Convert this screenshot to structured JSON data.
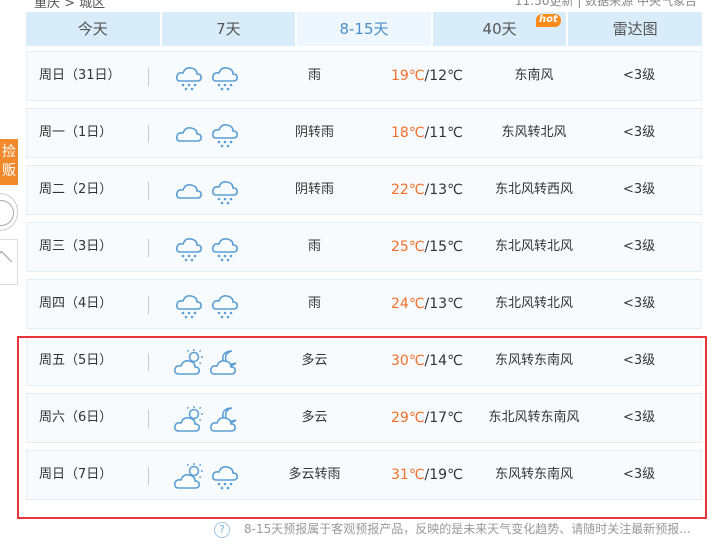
{
  "header": {
    "breadcrumb": "重庆 > 城区",
    "update_text": "11:50更新  |  数据来源 中央气象台"
  },
  "tabs": [
    {
      "label": "今天",
      "active": false
    },
    {
      "label": "7天",
      "active": false
    },
    {
      "label": "8-15天",
      "active": true
    },
    {
      "label": "40天",
      "active": false,
      "badge": "hot"
    },
    {
      "label": "雷达图",
      "active": false
    }
  ],
  "sidebar": {
    "button_label": "捡\n贩"
  },
  "forecast": [
    {
      "day": "周日（31日）",
      "icons": [
        "rain",
        "rain"
      ],
      "condition": "雨",
      "high": "19℃",
      "low": "12℃",
      "wind": "东南风",
      "level": "<3级"
    },
    {
      "day": "周一（1日）",
      "icons": [
        "cloudy",
        "rain"
      ],
      "condition": "阴转雨",
      "high": "18℃",
      "low": "11℃",
      "wind": "东风转北风",
      "level": "<3级"
    },
    {
      "day": "周二（2日）",
      "icons": [
        "cloudy",
        "rain"
      ],
      "condition": "阴转雨",
      "high": "22℃",
      "low": "13℃",
      "wind": "东北风转西风",
      "level": "<3级"
    },
    {
      "day": "周三（3日）",
      "icons": [
        "rain",
        "rain"
      ],
      "condition": "雨",
      "high": "25℃",
      "low": "15℃",
      "wind": "东北风转北风",
      "level": "<3级"
    },
    {
      "day": "周四（4日）",
      "icons": [
        "rain",
        "rain"
      ],
      "condition": "雨",
      "high": "24℃",
      "low": "13℃",
      "wind": "东北风转北风",
      "level": "<3级"
    },
    {
      "day": "周五（5日）",
      "icons": [
        "partly-cloudy-day",
        "partly-cloudy-night"
      ],
      "condition": "多云",
      "high": "30℃",
      "low": "14℃",
      "wind": "东风转东南风",
      "level": "<3级"
    },
    {
      "day": "周六（6日）",
      "icons": [
        "partly-cloudy-day",
        "partly-cloudy-night"
      ],
      "condition": "多云",
      "high": "29℃",
      "low": "17℃",
      "wind": "东北风转东南风",
      "level": "<3级"
    },
    {
      "day": "周日（7日）",
      "icons": [
        "partly-cloudy-day",
        "rain"
      ],
      "condition": "多云转雨",
      "high": "31℃",
      "low": "19℃",
      "wind": "东风转东南风",
      "level": "<3级"
    }
  ],
  "footer_note": "8-15天预报属于客观预报产品，反映的是未来天气变化趋势、请随时关注最新预报...",
  "colors": {
    "accent": "#4a90c8",
    "high_temp": "#f26e2b",
    "highlight_border": "#e8373b",
    "tab_bg": "#d9ecf9"
  }
}
